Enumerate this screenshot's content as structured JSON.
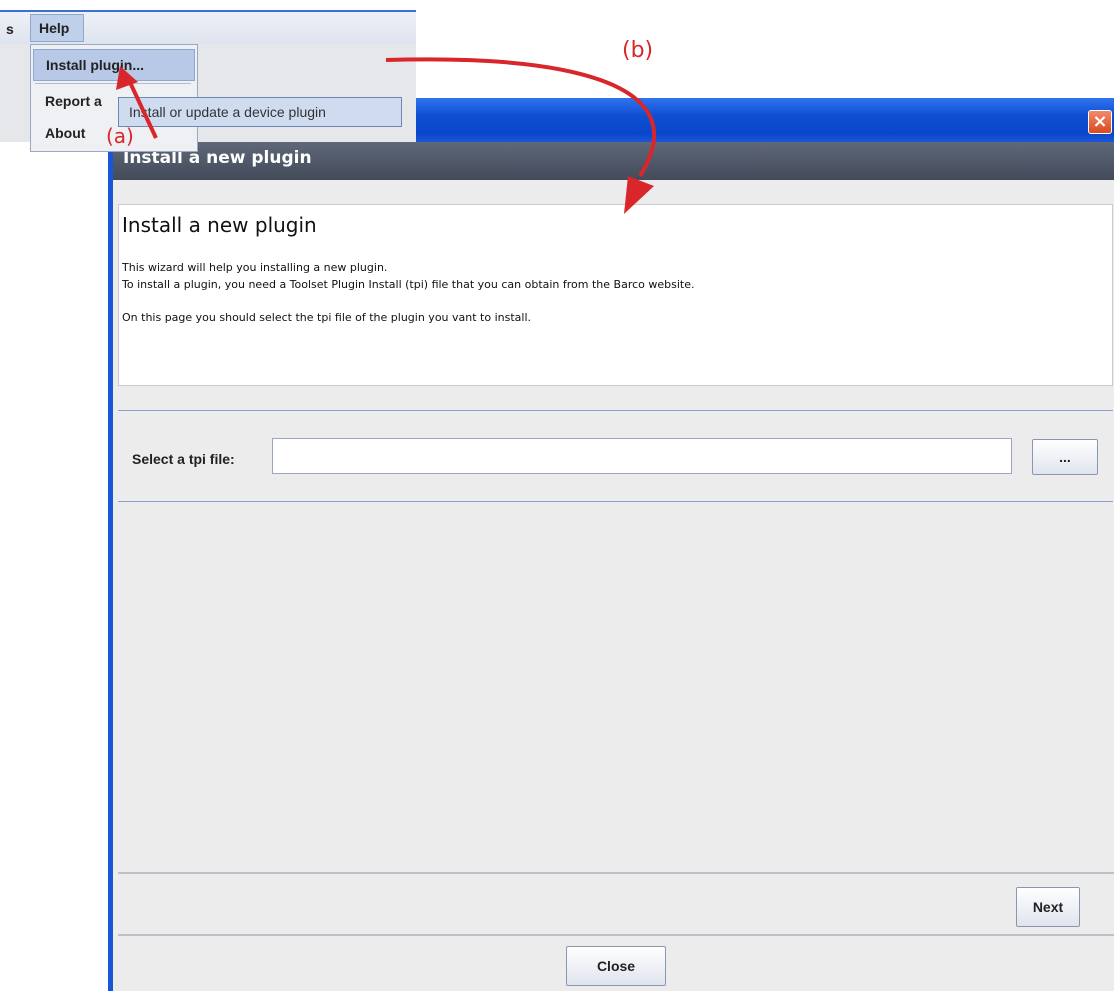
{
  "menubar": {
    "partial_item": "s",
    "help_label": "Help",
    "dropdown": {
      "items": [
        {
          "label": "Install plugin..."
        },
        {
          "label": "Report a"
        },
        {
          "label": "About"
        }
      ],
      "tooltip": "Install or update a device plugin"
    }
  },
  "annotations": {
    "a": "(a)",
    "b": "(b)",
    "color": "#d8262a"
  },
  "wizard": {
    "header_title": "Install a new plugin",
    "description": {
      "title": "Install a new plugin",
      "lines": [
        "This wizard will help you installing a new plugin.",
        "To install a plugin, you need a Toolset Plugin Install (tpi) file that you can obtain from the Barco website.",
        "On this page you should select the tpi file of the plugin you vant to install."
      ]
    },
    "file_label": "Select a tpi file:",
    "file_value": "",
    "browse_label": "...",
    "next_label": "Next",
    "close_label": "Close",
    "titlebar_close_icon": "close-icon",
    "colors": {
      "titlebar": "#0e4fd2",
      "header_band": "#4f5768",
      "background": "#ececec"
    }
  }
}
